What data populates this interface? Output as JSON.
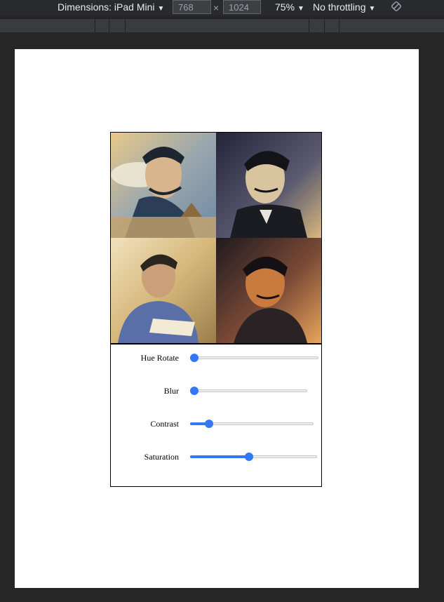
{
  "devtools": {
    "dimensions_label": "Dimensions: iPad Mini",
    "width_value": "768",
    "height_value": "1024",
    "times_symbol": "×",
    "zoom": "75%",
    "throttling": "No throttling",
    "caret": "▼"
  },
  "gallery": {
    "tiles": [
      {
        "name": "portrait-1",
        "colors": [
          "#c9b48a",
          "#2c3e57",
          "#e8d9b6"
        ]
      },
      {
        "name": "portrait-2",
        "colors": [
          "#3b3a4a",
          "#d9c4a0",
          "#1b1b22"
        ]
      },
      {
        "name": "portrait-3",
        "colors": [
          "#d6b77a",
          "#5a6ea8",
          "#f3ead6"
        ]
      },
      {
        "name": "portrait-4",
        "colors": [
          "#2b2226",
          "#c97a3e",
          "#e9a55c"
        ]
      }
    ]
  },
  "controls": {
    "items": [
      {
        "label": "Hue Rotate",
        "value": 0.0
      },
      {
        "label": "Blur",
        "value": 0.0
      },
      {
        "label": "Contrast",
        "value": 0.13
      },
      {
        "label": "Saturation",
        "value": 0.46
      }
    ],
    "accent": "#3478f6"
  }
}
